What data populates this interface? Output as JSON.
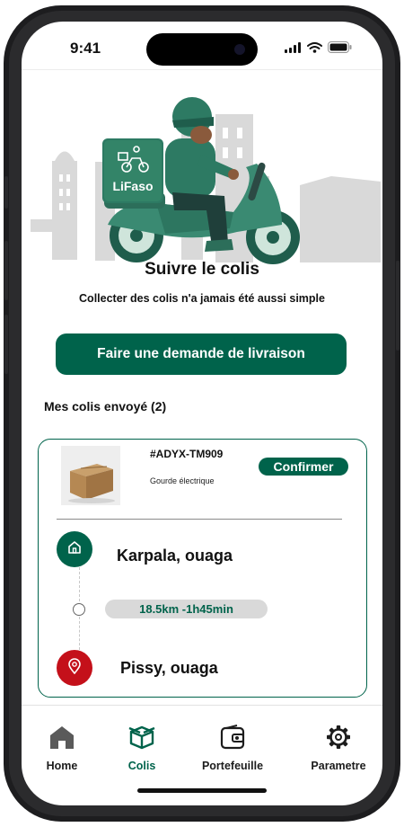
{
  "status_bar": {
    "time": "9:41",
    "icons": [
      "signal-icon",
      "wifi-icon",
      "battery-icon"
    ]
  },
  "hero": {
    "illustration": "delivery-scooter-illustration",
    "logo_text": "LiFaso"
  },
  "title": "Suivre le colis",
  "subtitle": "Collecter des colis n'a jamais été aussi simple",
  "cta": {
    "label": "Faire une demande de livraison"
  },
  "sent_section": {
    "title": "Mes colis envoyé (2)"
  },
  "parcel": {
    "tracking_id": "#ADYX-TM909",
    "product": "Gourde électrique",
    "confirm_label": "Confirmer",
    "origin": "Karpala, ouaga",
    "distance_eta": "18.5km -1h45min",
    "destination": "Pissy, ouaga"
  },
  "tab_bar": {
    "items": [
      {
        "label": "Home",
        "icon": "home-icon",
        "active": false
      },
      {
        "label": "Colis",
        "icon": "package-icon",
        "active": true
      },
      {
        "label": "Portefeuille",
        "icon": "wallet-icon",
        "active": false
      },
      {
        "label": "Parametre",
        "icon": "gear-icon",
        "active": false
      }
    ]
  },
  "colors": {
    "primary": "#00634b",
    "danger": "#c4101a",
    "pill_bg": "#d9d9d9",
    "text": "#111111"
  }
}
